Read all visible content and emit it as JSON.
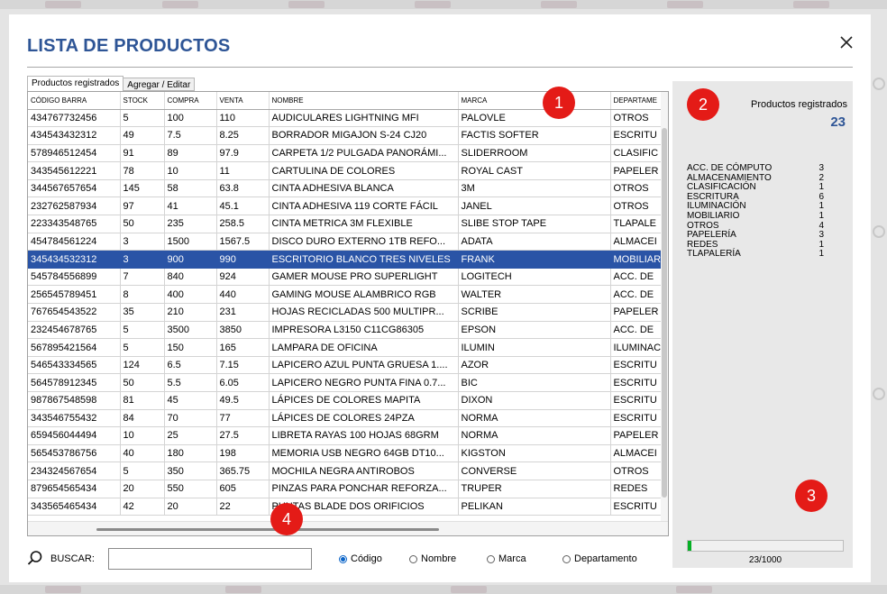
{
  "window": {
    "title": "LISTA DE PRODUCTOS"
  },
  "tabs": [
    {
      "label": "Productos registrados",
      "active": true
    },
    {
      "label": "Agregar / Editar",
      "active": false
    }
  ],
  "table": {
    "columns": [
      "CÓDIGO BARRA",
      "STOCK",
      "COMPRA",
      "VENTA",
      "NOMBRE",
      "MARCA",
      "DEPARTAME"
    ],
    "selected_index": 8,
    "rows": [
      [
        "434767732456",
        "5",
        "100",
        "110",
        "AUDICULARES LIGHTNING MFI",
        "PALOVLE",
        "OTROS"
      ],
      [
        "434543432312",
        "49",
        "7.5",
        "8.25",
        "BORRADOR MIGAJON S-24 CJ20",
        "FACTIS SOFTER",
        "ESCRITU"
      ],
      [
        "578946512454",
        "91",
        "89",
        "97.9",
        "CARPETA 1/2 PULGADA PANORÁMI...",
        "SLIDERROOM",
        "CLASIFIC"
      ],
      [
        "343545612221",
        "78",
        "10",
        "11",
        "CARTULINA DE COLORES",
        "ROYAL CAST",
        "PAPELER"
      ],
      [
        "344567657654",
        "145",
        "58",
        "63.8",
        "CINTA ADHESIVA BLANCA",
        "3M",
        "OTROS"
      ],
      [
        "232762587934",
        "97",
        "41",
        "45.1",
        "CINTA ADHESIVA 119 CORTE FÁCIL",
        "JANEL",
        "OTROS"
      ],
      [
        "223343548765",
        "50",
        "235",
        "258.5",
        "CINTA METRICA 3M FLEXIBLE",
        "SLIBE STOP TAPE",
        "TLAPALE"
      ],
      [
        "454784561224",
        "3",
        "1500",
        "1567.5",
        "DISCO DURO EXTERNO 1TB REFO...",
        "ADATA",
        "ALMACEI"
      ],
      [
        "345434532312",
        "3",
        "900",
        "990",
        "ESCRITORIO BLANCO TRES NIVELES",
        "FRANK",
        "MOBILIAR"
      ],
      [
        "545784556899",
        "7",
        "840",
        "924",
        "GAMER MOUSE PRO SUPERLIGHT",
        "LOGITECH",
        "ACC. DE"
      ],
      [
        "256545789451",
        "8",
        "400",
        "440",
        "GAMING MOUSE ALAMBRICO RGB",
        "WALTER",
        "ACC. DE"
      ],
      [
        "767654543522",
        "35",
        "210",
        "231",
        "HOJAS RECICLADAS 500 MULTIPR...",
        "SCRIBE",
        "PAPELER"
      ],
      [
        "232454678765",
        "5",
        "3500",
        "3850",
        "IMPRESORA L3150 C11CG86305",
        "EPSON",
        "ACC. DE"
      ],
      [
        "567895421564",
        "5",
        "150",
        "165",
        "LAMPARA DE OFICINA",
        "ILUMIN",
        "ILUMINAC"
      ],
      [
        "546543334565",
        "124",
        "6.5",
        "7.15",
        "LAPICERO AZUL PUNTA GRUESA 1....",
        "AZOR",
        "ESCRITU"
      ],
      [
        "564578912345",
        "50",
        "5.5",
        "6.05",
        "LAPICERO NEGRO PUNTA FINA 0.7...",
        "BIC",
        "ESCRITU"
      ],
      [
        "987867548598",
        "81",
        "45",
        "49.5",
        "LÁPICES DE COLORES MAPITA",
        "DIXON",
        "ESCRITU"
      ],
      [
        "343546755432",
        "84",
        "70",
        "77",
        "LÁPICES DE COLORES 24PZA",
        "NORMA",
        "ESCRITU"
      ],
      [
        "659456044494",
        "10",
        "25",
        "27.5",
        "LIBRETA RAYAS 100 HOJAS 68GRM",
        "NORMA",
        "PAPELER"
      ],
      [
        "565453786756",
        "40",
        "180",
        "198",
        "MEMORIA USB NEGRO 64GB DT10...",
        "KIGSTON",
        "ALMACEI"
      ],
      [
        "234324567654",
        "5",
        "350",
        "365.75",
        "MOCHILA NEGRA ANTIROBOS",
        "CONVERSE",
        "OTROS"
      ],
      [
        "879654565434",
        "20",
        "550",
        "605",
        "PINZAS PARA PONCHAR REFORZA...",
        "TRUPER",
        "REDES"
      ],
      [
        "343565465434",
        "42",
        "20",
        "22",
        "PUNTAS BLADE DOS ORIFICIOS",
        "PELIKAN",
        "ESCRITU"
      ]
    ]
  },
  "summary": {
    "title": "Productos registrados",
    "count": "23",
    "categories": [
      {
        "name": "ACC. DE CÓMPUTO",
        "count": "3"
      },
      {
        "name": "ALMACENAMIENTO",
        "count": "2"
      },
      {
        "name": "CLASIFICACIÓN",
        "count": "1"
      },
      {
        "name": "ESCRITURA",
        "count": "6"
      },
      {
        "name": "ILUMINACIÓN",
        "count": "1"
      },
      {
        "name": "MOBILIARIO",
        "count": "1"
      },
      {
        "name": "OTROS",
        "count": "4"
      },
      {
        "name": "PAPELERÍA",
        "count": "3"
      },
      {
        "name": "REDES",
        "count": "1"
      },
      {
        "name": "TLAPALERÍA",
        "count": "1"
      }
    ],
    "progress_fraction": 0.023,
    "progress_text": "23/1000"
  },
  "search": {
    "label": "BUSCAR:",
    "value": "",
    "options": [
      {
        "label": "Código",
        "checked": true
      },
      {
        "label": "Nombre",
        "checked": false
      },
      {
        "label": "Marca",
        "checked": false
      },
      {
        "label": "Departamento",
        "checked": false
      }
    ]
  },
  "markers": [
    "1",
    "2",
    "3",
    "4"
  ],
  "colors": {
    "title": "#2e5596",
    "selection": "#2a54a6",
    "marker": "#e41b17",
    "radio_checked": "#0a64c8"
  }
}
